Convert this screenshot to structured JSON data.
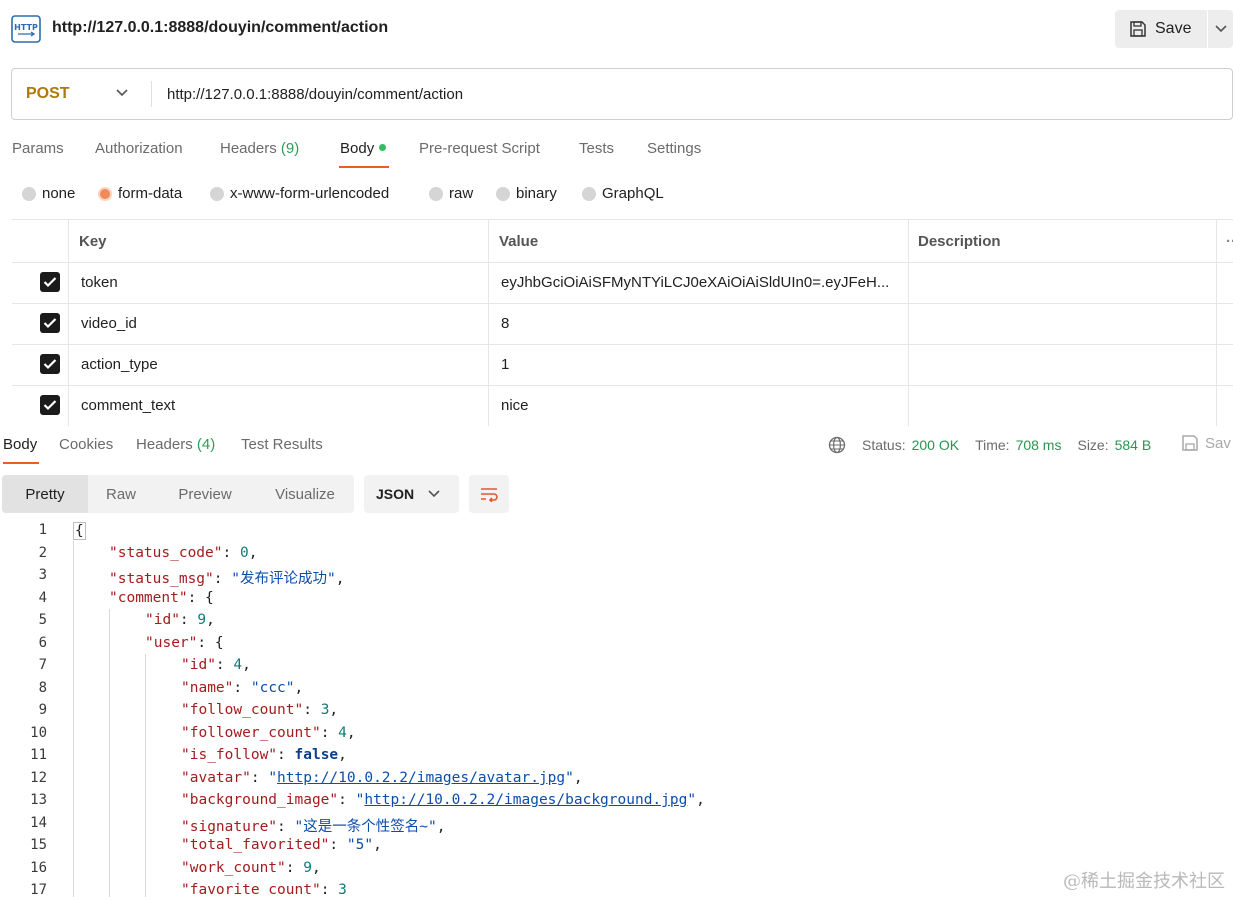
{
  "header": {
    "title_url": "http://127.0.0.1:8888/douyin/comment/action",
    "save_label": "Save"
  },
  "request": {
    "method": "POST",
    "url": "http://127.0.0.1:8888/douyin/comment/action"
  },
  "request_tabs": {
    "params": "Params",
    "authorization": "Authorization",
    "headers": "Headers",
    "headers_count": "(9)",
    "body": "Body",
    "prerequest": "Pre-request Script",
    "tests": "Tests",
    "settings": "Settings"
  },
  "body_types": {
    "none": "none",
    "form_data": "form-data",
    "urlencoded": "x-www-form-urlencoded",
    "raw": "raw",
    "binary": "binary",
    "graphql": "GraphQL",
    "selected": "form-data"
  },
  "params_table": {
    "headers": {
      "key": "Key",
      "value": "Value",
      "description": "Description"
    },
    "rows": [
      {
        "key": "token",
        "value": "eyJhbGciOiAiSFMyNTYiLCJ0eXAiOiAiSldUIn0=.eyJFeH...",
        "checked": true
      },
      {
        "key": "video_id",
        "value": "8",
        "checked": true
      },
      {
        "key": "action_type",
        "value": "1",
        "checked": true
      },
      {
        "key": "comment_text",
        "value": "nice",
        "checked": true
      }
    ]
  },
  "response_tabs": {
    "body": "Body",
    "cookies": "Cookies",
    "headers": "Headers",
    "headers_count": "(4)",
    "test_results": "Test Results"
  },
  "status": {
    "status_label": "Status:",
    "status_value": "200 OK",
    "time_label": "Time:",
    "time_value": "708 ms",
    "size_label": "Size:",
    "size_value": "584 B",
    "save_label": "Sav"
  },
  "view_modes": {
    "pretty": "Pretty",
    "raw": "Raw",
    "preview": "Preview",
    "visualize": "Visualize",
    "format": "JSON"
  },
  "code": {
    "line_numbers": [
      "1",
      "2",
      "3",
      "4",
      "5",
      "6",
      "7",
      "8",
      "9",
      "10",
      "11",
      "12",
      "13",
      "14",
      "15",
      "16",
      "17"
    ],
    "l1": "{",
    "l2_key": "\"status_code\"",
    "l2_val": "0",
    "l3_key": "\"status_msg\"",
    "l3_val": "\"发布评论成功\"",
    "l4_key": "\"comment\"",
    "l5_key": "\"id\"",
    "l5_val": "9",
    "l6_key": "\"user\"",
    "l7_key": "\"id\"",
    "l7_val": "4",
    "l8_key": "\"name\"",
    "l8_val": "\"ccc\"",
    "l9_key": "\"follow_count\"",
    "l9_val": "3",
    "l10_key": "\"follower_count\"",
    "l10_val": "4",
    "l11_key": "\"is_follow\"",
    "l11_val": "false",
    "l12_key": "\"avatar\"",
    "l12_val": "http://10.0.2.2/images/avatar.jpg",
    "l13_key": "\"background_image\"",
    "l13_val": "http://10.0.2.2/images/background.jpg",
    "l14_key": "\"signature\"",
    "l14_val": "\"这是一条个性签名~\"",
    "l15_key": "\"total_favorited\"",
    "l15_val": "\"5\"",
    "l16_key": "\"work_count\"",
    "l16_val": "9",
    "l17_key": "\"favorite_count\"",
    "l17_val": "3"
  },
  "watermark": "@稀土掘金技术社区"
}
